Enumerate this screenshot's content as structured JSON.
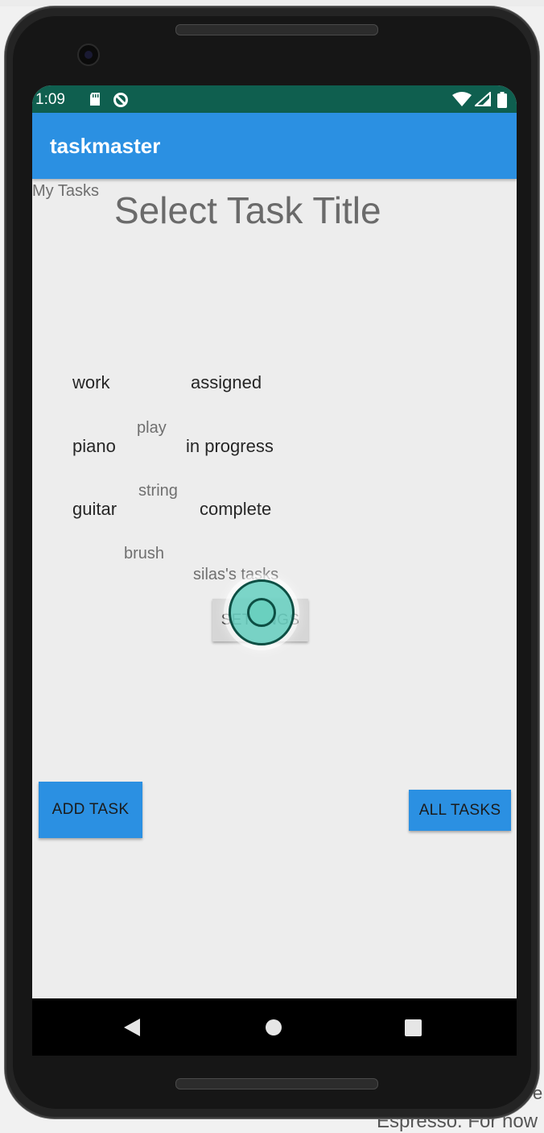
{
  "status_bar": {
    "time": "1:09"
  },
  "app_bar": {
    "title": "taskmaster"
  },
  "header": {
    "my_tasks_label": "My Tasks",
    "title": "Select Task Title"
  },
  "task_titles": [
    "work",
    "piano",
    "guitar"
  ],
  "task_bodies": [
    "play",
    "string",
    "brush"
  ],
  "task_states": [
    "assigned",
    "in progress",
    "complete"
  ],
  "user_tasks_label": "silas's tasks",
  "buttons": {
    "settings": "SETTINGS",
    "add_task": "ADD TASK",
    "all_tasks": "ALL TASKS"
  },
  "background": {
    "caption": "Espresso. For now",
    "edge_char": "e"
  }
}
